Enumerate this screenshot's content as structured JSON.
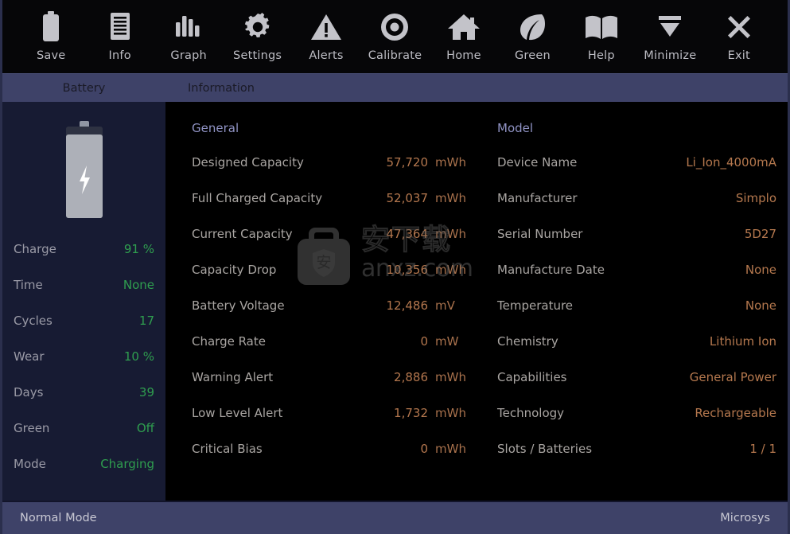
{
  "toolbar": {
    "items": [
      {
        "label": "Save",
        "icon": "battery-save-icon"
      },
      {
        "label": "Info",
        "icon": "document-info-icon"
      },
      {
        "label": "Graph",
        "icon": "bar-chart-icon"
      },
      {
        "label": "Settings",
        "icon": "gear-icon"
      },
      {
        "label": "Alerts",
        "icon": "warning-triangle-icon"
      },
      {
        "label": "Calibrate",
        "icon": "target-circle-icon"
      },
      {
        "label": "Home",
        "icon": "home-icon"
      },
      {
        "label": "Green",
        "icon": "leaf-icon"
      },
      {
        "label": "Help",
        "icon": "book-icon"
      },
      {
        "label": "Minimize",
        "icon": "minimize-icon"
      },
      {
        "label": "Exit",
        "icon": "close-x-icon"
      }
    ]
  },
  "header": {
    "segment_left": "Battery",
    "segment_right": "Information"
  },
  "sidebar": {
    "battery_icon": "battery-charging-icon",
    "charge_fill_percent": 91,
    "stats": [
      {
        "key": "Charge",
        "value": "91 %"
      },
      {
        "key": "Time",
        "value": "None"
      },
      {
        "key": "Cycles",
        "value": "17"
      },
      {
        "key": "Wear",
        "value": "10 %"
      },
      {
        "key": "Days",
        "value": "39"
      },
      {
        "key": "Green",
        "value": "Off"
      },
      {
        "key": "Mode",
        "value": "Charging"
      }
    ]
  },
  "main": {
    "general": {
      "title": "General",
      "rows": [
        {
          "key": "Designed Capacity",
          "value": "57,720",
          "unit": "mWh"
        },
        {
          "key": "Full Charged Capacity",
          "value": "52,037",
          "unit": "mWh"
        },
        {
          "key": "Current Capacity",
          "value": "47,364",
          "unit": "mWh"
        },
        {
          "key": "Capacity Drop",
          "value": "10,356",
          "unit": "mWh"
        },
        {
          "key": "Battery Voltage",
          "value": "12,486",
          "unit": "mV"
        },
        {
          "key": "Charge Rate",
          "value": "0",
          "unit": "mW"
        },
        {
          "key": "Warning Alert",
          "value": "2,886",
          "unit": "mWh"
        },
        {
          "key": "Low Level Alert",
          "value": "1,732",
          "unit": "mWh"
        },
        {
          "key": "Critical Bias",
          "value": "0",
          "unit": "mWh"
        }
      ]
    },
    "model": {
      "title": "Model",
      "rows": [
        {
          "key": "Device Name",
          "value": "Li_Ion_4000mA"
        },
        {
          "key": "Manufacturer",
          "value": "Simplo"
        },
        {
          "key": "Serial Number",
          "value": "5D27"
        },
        {
          "key": "Manufacture Date",
          "value": "None"
        },
        {
          "key": "Temperature",
          "value": "None"
        },
        {
          "key": "Chemistry",
          "value": "Lithium Ion"
        },
        {
          "key": "Capabilities",
          "value": "General Power"
        },
        {
          "key": "Technology",
          "value": "Rechargeable"
        },
        {
          "key": "Slots / Batteries",
          "value": "1 / 1"
        }
      ]
    }
  },
  "watermark": {
    "cn_text": "安下载",
    "url_text": "anxz.com",
    "icon": "briefcase-shield-icon"
  },
  "statusbar": {
    "left": "Normal Mode",
    "right": "Microsys"
  },
  "colors": {
    "header_bar": "#3e4268",
    "sidebar_bg": "#171b33",
    "main_bg": "#000000",
    "toolbar_bg": "#060608",
    "stat_value_green": "#2f9e4f",
    "row_value_orange": "#b4774e",
    "col_title_blue": "#9093c4",
    "row_key_grey": "#a9a5a2"
  }
}
